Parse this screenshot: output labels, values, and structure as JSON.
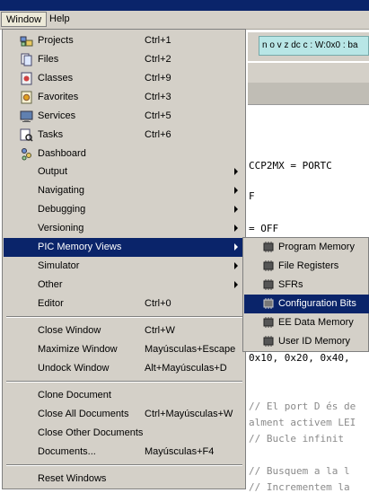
{
  "menubar": {
    "items": [
      {
        "label": "Window"
      },
      {
        "label": "Help"
      }
    ]
  },
  "debug": {
    "status_text": "n o v z dc c  : W:0x0 : ba"
  },
  "code_lines": [
    "CCP2MX = PORTC",
    "F",
    "= OFF",
    "0x10, 0x20, 0x40,",
    "// El port D és de",
    "alment activem LEI",
    "// Bucle infinit",
    "// Busquem a la l",
    "// Incrementem la"
  ],
  "window_menu": {
    "items": [
      {
        "label": "Projects",
        "shortcut": "Ctrl+1",
        "icon": "projects-icon"
      },
      {
        "label": "Files",
        "shortcut": "Ctrl+2",
        "icon": "files-icon"
      },
      {
        "label": "Classes",
        "shortcut": "Ctrl+9",
        "icon": "classes-icon"
      },
      {
        "label": "Favorites",
        "shortcut": "Ctrl+3",
        "icon": "favorites-icon"
      },
      {
        "label": "Services",
        "shortcut": "Ctrl+5",
        "icon": "services-icon"
      },
      {
        "label": "Tasks",
        "shortcut": "Ctrl+6",
        "icon": "tasks-icon"
      },
      {
        "label": "Dashboard",
        "shortcut": "",
        "icon": "dashboard-icon"
      },
      {
        "label": "Output",
        "submenu": true
      },
      {
        "label": "Navigating",
        "submenu": true
      },
      {
        "label": "Debugging",
        "submenu": true
      },
      {
        "label": "Versioning",
        "submenu": true
      },
      {
        "label": "PIC Memory Views",
        "submenu": true,
        "highlighted": true
      },
      {
        "label": "Simulator",
        "submenu": true
      },
      {
        "label": "Other",
        "submenu": true
      },
      {
        "label": "Editor",
        "shortcut": "Ctrl+0"
      },
      {
        "label": "Close Window",
        "shortcut": "Ctrl+W"
      },
      {
        "label": "Maximize Window",
        "shortcut": "Mayúsculas+Escape"
      },
      {
        "label": "Undock Window",
        "shortcut": "Alt+Mayúsculas+D"
      },
      {
        "label": "Clone Document"
      },
      {
        "label": "Close All Documents",
        "shortcut": "Ctrl+Mayúsculas+W"
      },
      {
        "label": "Close Other Documents"
      },
      {
        "label": "Documents...",
        "shortcut": "Mayúsculas+F4"
      },
      {
        "label": "Reset Windows"
      }
    ]
  },
  "pic_memory_submenu": {
    "items": [
      {
        "label": "Program Memory"
      },
      {
        "label": "File Registers"
      },
      {
        "label": "SFRs"
      },
      {
        "label": "Configuration Bits",
        "highlighted": true
      },
      {
        "label": "EE Data Memory"
      },
      {
        "label": "User ID Memory"
      }
    ]
  },
  "colors": {
    "highlight": "#0a246a",
    "menu_bg": "#d4d0c8"
  }
}
